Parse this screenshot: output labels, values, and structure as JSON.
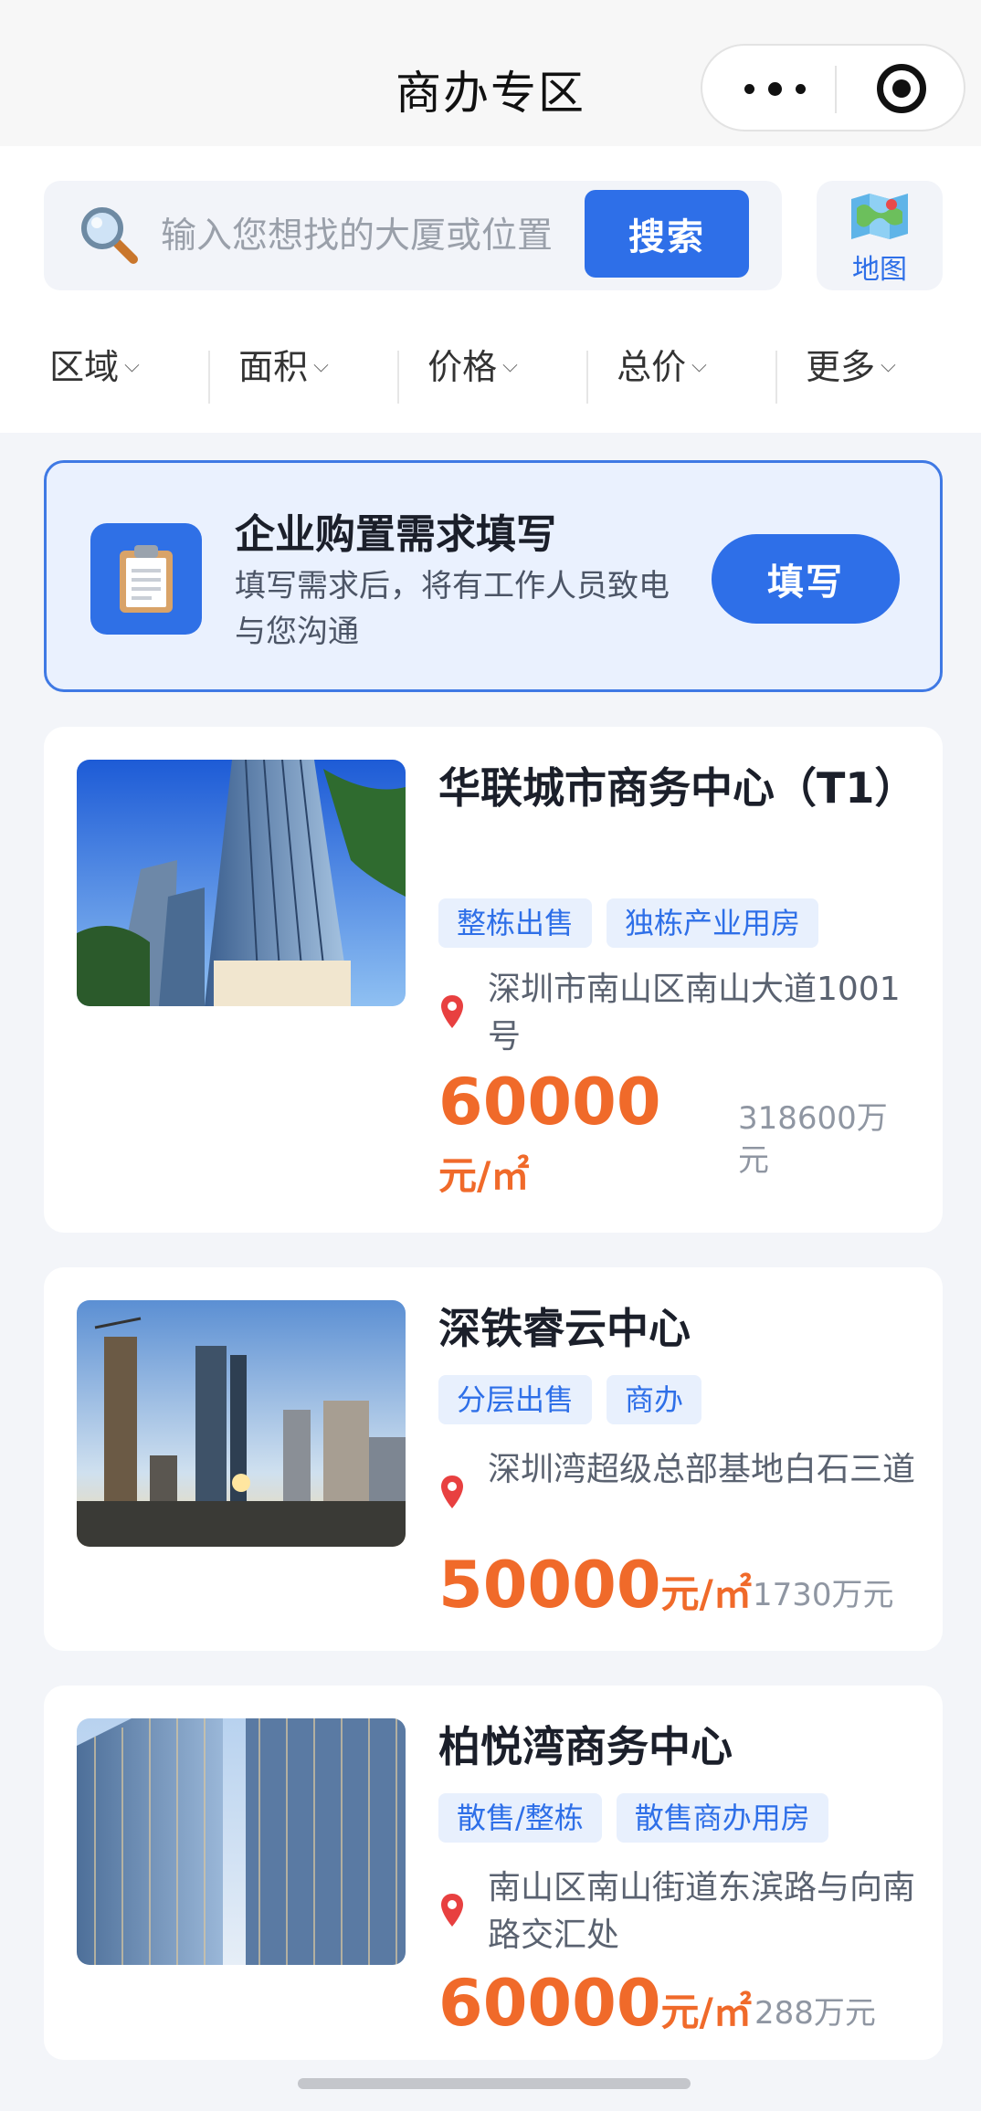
{
  "nav": {
    "title": "商办专区"
  },
  "search": {
    "placeholder": "输入您想找的大厦或位置",
    "button_label": "搜索",
    "map_label": "地图"
  },
  "filters": [
    "区域",
    "面积",
    "价格",
    "总价",
    "更多"
  ],
  "banner": {
    "title": "企业购置需求填写",
    "subtitle": "填写需求后，将有工作人员致电与您沟通",
    "button_label": "填写"
  },
  "listings": [
    {
      "title": "华联城市商务中心（T1）",
      "tags": [
        "整栋出售",
        "独栋产业用房"
      ],
      "address": "深圳市南山区南山大道1001号",
      "price": "60000",
      "price_unit": "元/㎡",
      "total": "318600万元"
    },
    {
      "title": "深铁睿云中心",
      "tags": [
        "分层出售",
        "商办"
      ],
      "address": "深圳湾超级总部基地白石三道",
      "price": "50000",
      "price_unit": "元/㎡",
      "total": "1730万元"
    },
    {
      "title": "柏悦湾商务中心",
      "tags": [
        "散售/整栋",
        "散售商办用房"
      ],
      "address": "南山区南山街道东滨路与向南路交汇处",
      "price": "60000",
      "price_unit": "元/㎡",
      "total": "288万元"
    }
  ],
  "colors": {
    "accent": "#2e6fe8",
    "price": "#f06a2a",
    "tag_bg": "#e8f0fd"
  }
}
